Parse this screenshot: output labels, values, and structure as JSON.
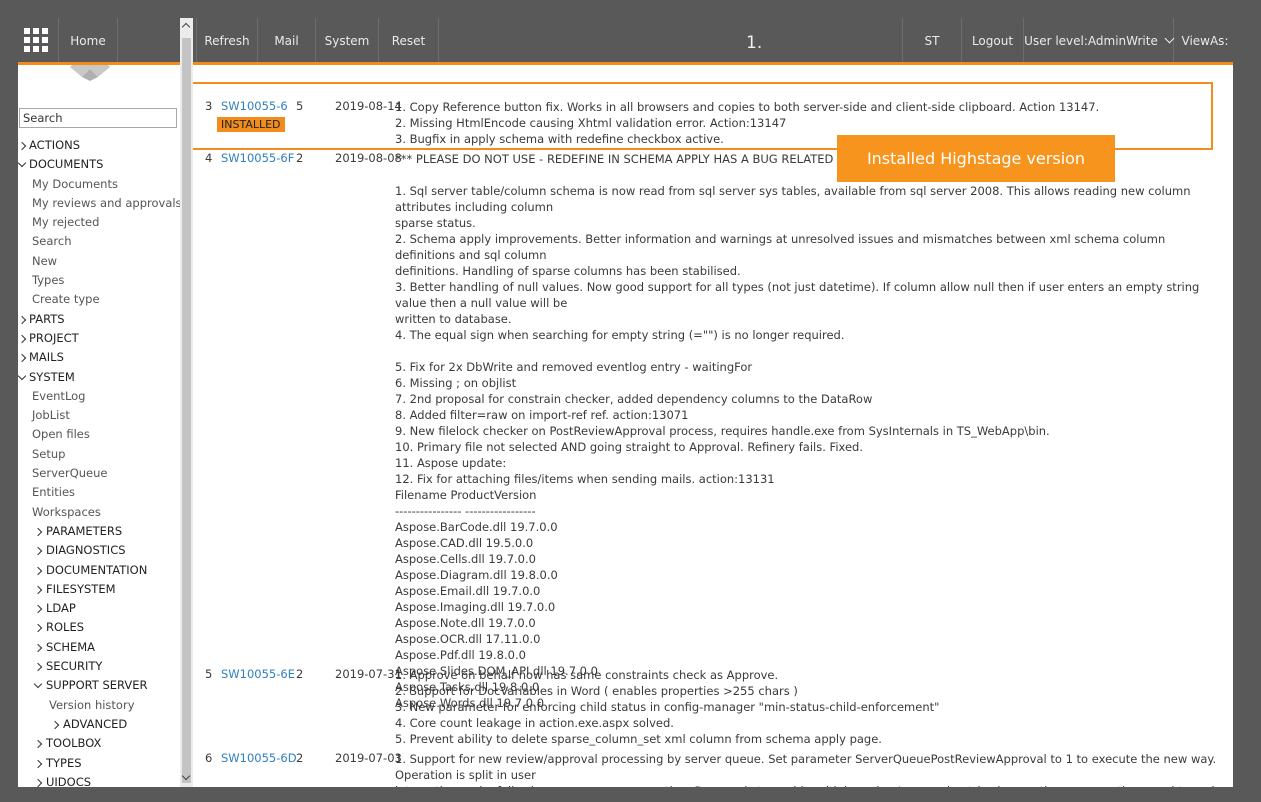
{
  "topbar": {
    "home": "Home",
    "refresh": "Refresh",
    "mail": "Mail",
    "system": "System",
    "reset": "Reset",
    "page_number": "1.",
    "st": "ST",
    "logout": "Logout",
    "user_level": "User level:AdminWrite",
    "views_as": "ViewAs:",
    "accent_color": "#f28c1d"
  },
  "sidebar": {
    "search_value": "Search",
    "items": [
      {
        "label": "ACTIONS",
        "level": "top",
        "arrow": "right"
      },
      {
        "label": "DOCUMENTS",
        "level": "top",
        "arrow": "down"
      },
      {
        "label": "My Documents",
        "level": "sub"
      },
      {
        "label": "My reviews and approvals",
        "level": "sub"
      },
      {
        "label": "My rejected",
        "level": "sub"
      },
      {
        "label": "Search",
        "level": "sub"
      },
      {
        "label": "New",
        "level": "sub"
      },
      {
        "label": "Types",
        "level": "sub"
      },
      {
        "label": "Create type",
        "level": "sub"
      },
      {
        "label": "PARTS",
        "level": "top",
        "arrow": "right"
      },
      {
        "label": "PROJECT",
        "level": "top",
        "arrow": "right"
      },
      {
        "label": "MAILS",
        "level": "top",
        "arrow": "right"
      },
      {
        "label": "SYSTEM",
        "level": "top",
        "arrow": "down"
      },
      {
        "label": "EventLog",
        "level": "sub"
      },
      {
        "label": "JobList",
        "level": "sub"
      },
      {
        "label": "Open files",
        "level": "sub"
      },
      {
        "label": "Setup",
        "level": "sub"
      },
      {
        "label": "ServerQueue",
        "level": "sub"
      },
      {
        "label": "Entities",
        "level": "sub"
      },
      {
        "label": "Workspaces",
        "level": "sub"
      },
      {
        "label": "PARAMETERS",
        "level": "sub2",
        "arrow": "right"
      },
      {
        "label": "DIAGNOSTICS",
        "level": "sub2",
        "arrow": "right"
      },
      {
        "label": "DOCUMENTATION",
        "level": "sub2",
        "arrow": "right"
      },
      {
        "label": "FILESYSTEM",
        "level": "sub2",
        "arrow": "right"
      },
      {
        "label": "LDAP",
        "level": "sub2",
        "arrow": "right"
      },
      {
        "label": "ROLES",
        "level": "sub2",
        "arrow": "right"
      },
      {
        "label": "SCHEMA",
        "level": "sub2",
        "arrow": "right"
      },
      {
        "label": "SECURITY",
        "level": "sub2",
        "arrow": "right"
      },
      {
        "label": "SUPPORT SERVER",
        "level": "sub2",
        "arrow": "down"
      },
      {
        "label": "Version history",
        "level": "sub3"
      },
      {
        "label": "ADVANCED",
        "level": "sub4",
        "arrow": "right"
      },
      {
        "label": "TOOLBOX",
        "level": "sub2",
        "arrow": "right"
      },
      {
        "label": "TYPES",
        "level": "sub2",
        "arrow": "right"
      },
      {
        "label": "UIDOCS",
        "level": "sub2",
        "arrow": "right"
      }
    ]
  },
  "versions": [
    {
      "num": "3",
      "id": "SW10055-6",
      "ver": "5",
      "date": "2019-08-14",
      "installed": "INSTALLED",
      "lines": [
        "1. Copy Reference button fix. Works in all browsers and copies to both server-side and client-side clipboard. Action 13147.",
        "2. Missing HtmlEncode causing Xhtml validation error. Action:13147",
        "3. Bugfix in apply schema with redefine checkbox active."
      ]
    },
    {
      "num": "4",
      "id": "SW10055-6F",
      "ver": "2",
      "date": "2019-08-08",
      "lines": [
        "*** PLEASE DO NOT USE - REDEFINE IN SCHEMA APPLY HAS A BUG RELATED TO NULL",
        "",
        "1. Sql server table/column schema is now read from sql server sys tables, available from sql server 2008. This allows reading new column attributes including column",
        "sparse status.",
        "2. Schema apply improvements. Better information and warnings at unresolved issues and mismatches between xml schema column definitions and sql column",
        "definitions. Handling of sparse columns has been stabilised.",
        "3. Better handling of null values. Now good support for all types (not just datetime). If column allow null then if user enters an empty string value then a null value will be",
        "written to database.",
        "4. The equal sign when searching for empty string (=\"\") is no longer required.",
        "",
        "5. Fix for 2x DbWrite and removed eventlog entry - waitingFor",
        "6. Missing ; on objlist",
        "7. 2nd proposal for constrain checker, added dependency columns to the DataRow",
        "8. Added filter=raw on import-ref ref. action:13071",
        "9. New filelock checker on PostReviewApproval process, requires handle.exe from SysInternals in TS_WebApp\\bin.",
        "10. Primary file not selected AND going straight to Approval. Refinery fails. Fixed.",
        "11. Aspose update:",
        "12. Fix for attaching files/items when sending mails. action:13131",
        "Filename ProductVersion",
        "---------------- -----------------",
        "Aspose.BarCode.dll 19.7.0.0",
        "Aspose.CAD.dll 19.5.0.0",
        "Aspose.Cells.dll 19.7.0.0",
        "Aspose.Diagram.dll 19.8.0.0",
        "Aspose.Email.dll 19.7.0.0",
        "Aspose.Imaging.dll 19.7.0.0",
        "Aspose.Note.dll 19.7.0.0",
        "Aspose.OCR.dll 17.11.0.0",
        "Aspose.Pdf.dll 19.8.0.0",
        "Aspose.Slides.DOM_API.dll 19.7.0.0",
        "Aspose.Tasks.dll 19.8.0.0",
        "Aspose.Words.dll 19.7.0.0"
      ]
    },
    {
      "num": "5",
      "id": "SW10055-6E",
      "ver": "2",
      "date": "2019-07-31",
      "lines": [
        "1. Approve on behalf now has same constraints check as Approve.",
        "2. Support for DocVariables in Word ( enables properties >255 chars )",
        "3. New parameter for enforcing child status in config-manager \"min-status-child-enforcement\"",
        "4. Core count leakage in action.exe.aspx solved.",
        "5. Prevent ability to delete sparse_column_set xml column from schema apply page."
      ]
    },
    {
      "num": "6",
      "id": "SW10055-6D",
      "ver": "2",
      "date": "2019-07-03",
      "lines": [
        "1. Support for new review/approval processing by server queue. Set parameter ServerQueuePostReviewApproval to 1 to execute the new way. Operation is split in user",
        "interaction and a following server queue operation. Purpose is to avoid multiple review/approval entries in eventlog on exceptions, and to make the operation more"
      ]
    }
  ],
  "callout": "Installed Highstage version"
}
